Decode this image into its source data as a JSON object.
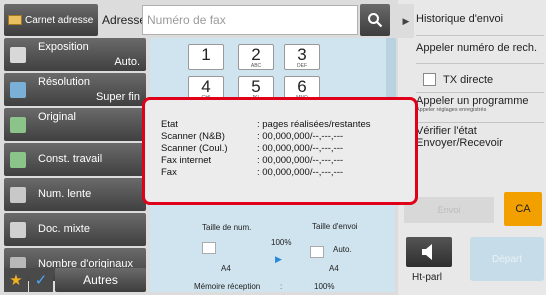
{
  "topbar": {
    "contacts_label": "Carnet adresse",
    "address_label": "Adresse",
    "fax_placeholder": "Numéro de fax"
  },
  "left_menu": {
    "exposure": {
      "label": "Exposition",
      "value": "Auto."
    },
    "resolution": {
      "label": "Résolution",
      "value": "Super fin"
    },
    "original": {
      "label": "Original"
    },
    "job_build": {
      "label": "Const. travail"
    },
    "slow_scan": {
      "label": "Num. lente"
    },
    "mixed_size": {
      "label": "Doc. mixte"
    },
    "originals_count": {
      "label": "Nombre d'originaux"
    },
    "others": "Autres"
  },
  "keypad": [
    {
      "digit": "1",
      "letters": ""
    },
    {
      "digit": "2",
      "letters": "ABC"
    },
    {
      "digit": "3",
      "letters": "DEF"
    },
    {
      "digit": "4",
      "letters": "GHI"
    },
    {
      "digit": "5",
      "letters": "JKL"
    },
    {
      "digit": "6",
      "letters": "MNO"
    }
  ],
  "status": {
    "scan_size_label": "Taille de num.",
    "send_size_label": "Taille d'envoi",
    "ratio": "100%",
    "auto": "Auto.",
    "scan_paper": "A4",
    "send_paper": "A4",
    "memory_label": "Mémoire réception",
    "memory_value": "100%"
  },
  "right_panel": {
    "history": "Historique d'envoi",
    "recall": "Appeler numéro de rech.",
    "direct_tx": "TX directe",
    "program": "Appeler un programme",
    "program_sub": "Appeler réglages enregistrés",
    "check_status": "Vérifier l'état",
    "send_receive": "Envoyer/Recevoir",
    "send": "Envoi",
    "ca": "CA",
    "on_hook": "Ht-parl",
    "start": "Départ"
  },
  "overlay": {
    "header": {
      "key": "Etat",
      "value": ": pages réalisées/restantes"
    },
    "rows": [
      {
        "key": "Scanner (N&B)",
        "value": ": 00,000,000/--,---,---"
      },
      {
        "key": "Scanner (Coul.)",
        "value": ": 00,000,000/--,---,---"
      },
      {
        "key": "Fax internet",
        "value": ": 00,000,000/--,---,---"
      },
      {
        "key": "Fax",
        "value": ": 00,000,000/--,---,---"
      }
    ]
  },
  "colors": {
    "highlight": "#e0001a",
    "ca_button": "#f2a000",
    "panel_blue": "#cfe4ef"
  }
}
